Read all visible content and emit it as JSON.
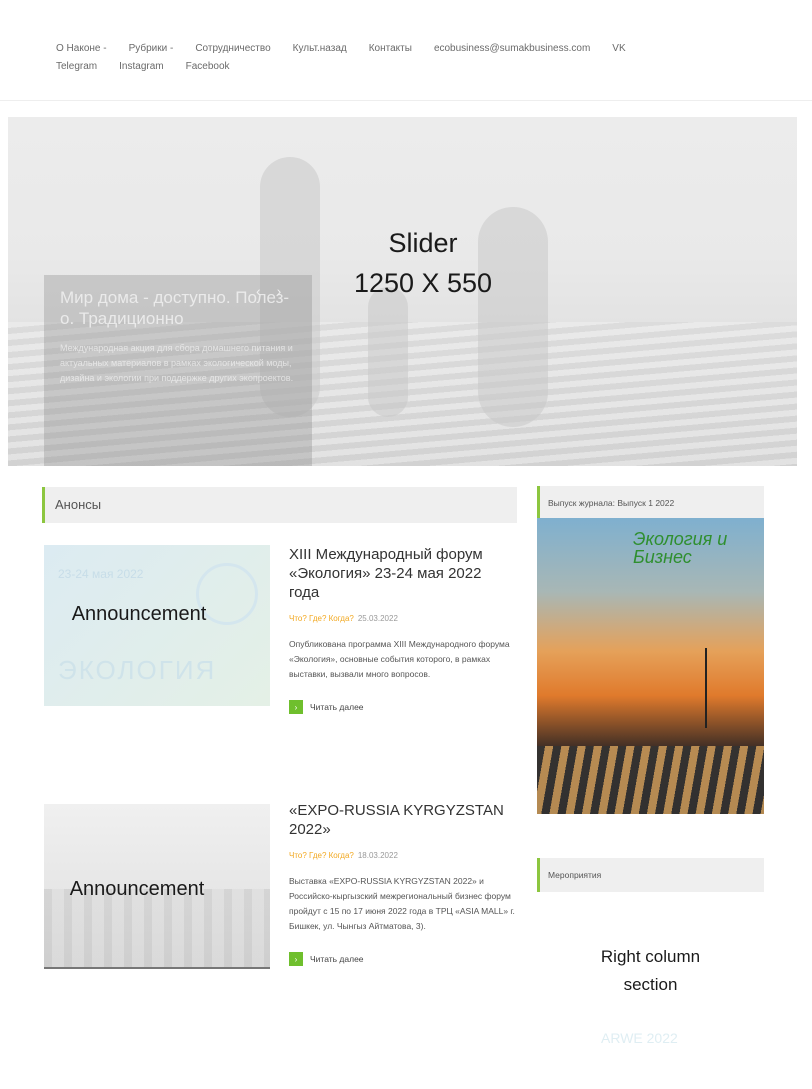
{
  "nav": {
    "row1": [
      "О Наконе -",
      "Рубрики -",
      "Сотрудничество",
      "Культ.назад",
      "Контакты",
      "ecobusiness@sumakbusiness.com",
      "VK"
    ],
    "row2": [
      "Telegram",
      "Instagram",
      "Facebook"
    ]
  },
  "slider": {
    "placeholder_line1": "Slider",
    "placeholder_line2": "1250 X 550",
    "caption_title": "Мир дома - доступно. Полез-о. Традиционно",
    "caption_text": "Международная акция для сбора домашнего питания и актуальных материалов в рамках экологической моды, дизайна и экологии при поддержке других экопроектов.",
    "prev_icon": "‹",
    "next_icon": "›"
  },
  "announcements": {
    "heading": "Анонсы",
    "items": [
      {
        "thumb_date": "23-24 мая 2022",
        "thumb_brand": "ЭКОЛОГИЯ",
        "thumb_placeholder": "Announcement",
        "title": "XIII Международный форум «Экология» 23-24 мая 2022 года",
        "meta": "Что? Где? Когда?",
        "date": "25.03.2022",
        "text": "Опубликована программа XIII Международного форума «Экология», основные события которого, в рамках выставки, вызвали много вопросов.",
        "more": "Читать далее"
      },
      {
        "thumb_placeholder": "Announcement",
        "title": "«EXPO-RUSSIA KYRGYZSTAN 2022»",
        "meta": "Что? Где? Когда?",
        "date": "18.03.2022",
        "text": "Выставка «EXPO-RUSSIA KYRGYZSTAN 2022» и Российско-кыргызский межрегиональный бизнес форум пройдут с 15 по 17 июня 2022 года в ТРЦ «ASIA MALL» г. Бишкек, ул. Чынгыз Айтматова, 3).",
        "more": "Читать далее"
      }
    ]
  },
  "sidebar": {
    "magazine_heading": "Выпуск журнала: Выпуск 1 2022",
    "magazine_logo": "Экология и Бизнес",
    "events_heading": "Мероприятия",
    "right_placeholder_line1": "Right column",
    "right_placeholder_line2": "section",
    "right_faint": "ARWE 2022"
  },
  "colors": {
    "accent_green": "#8cc63f",
    "meta_orange": "#f2a820"
  }
}
